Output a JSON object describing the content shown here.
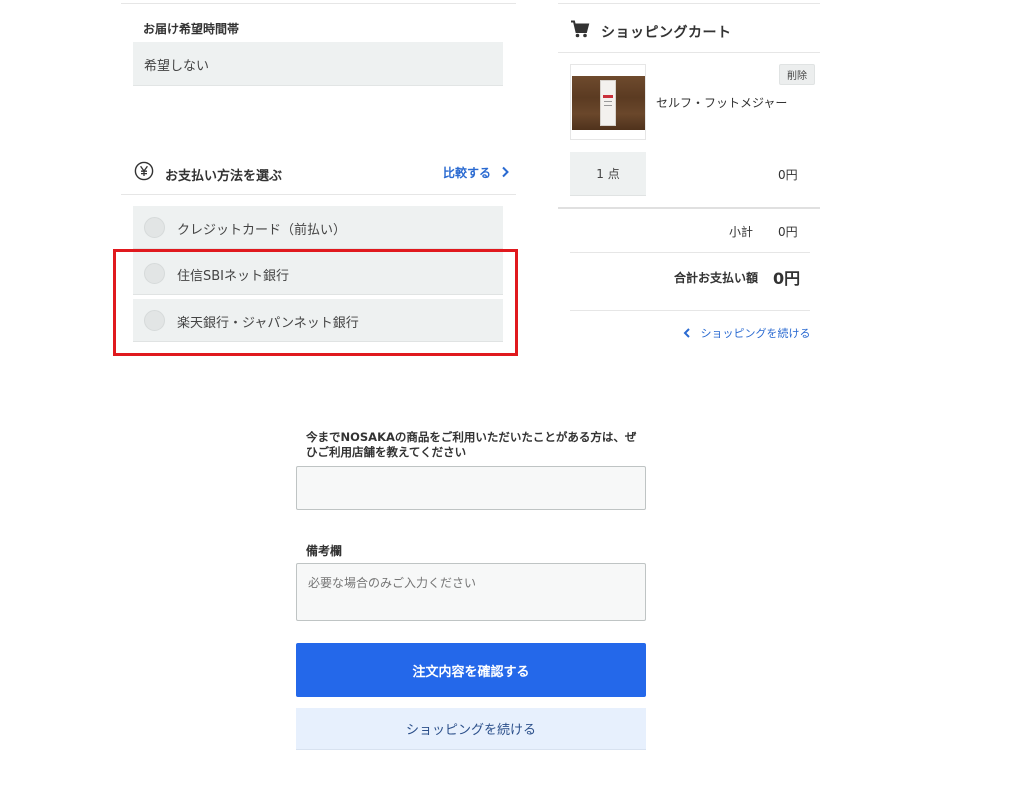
{
  "delivery": {
    "time_label": "お届け希望時間帯",
    "time_value": "希望しない"
  },
  "payment": {
    "icon": "yen-circle-icon",
    "title": "お支払い方法を選ぶ",
    "compare_link": "比較する",
    "compare_icon": "chevron-right-icon",
    "options": [
      {
        "label": "クレジットカード（前払い）"
      },
      {
        "label": "住信SBIネット銀行"
      },
      {
        "label": "楽天銀行・ジャパンネット銀行"
      }
    ],
    "highlight_color": "#e0191e"
  },
  "cart": {
    "icon": "shopping-cart-icon",
    "title": "ショッピングカート",
    "item": {
      "name": "セルフ・フットメジャー",
      "delete_label": "削除",
      "quantity": "1 点",
      "price": "0円"
    },
    "subtotal_label": "小計",
    "subtotal_value": "0円",
    "total_label": "合計お支払い額",
    "total_value": "0円",
    "continue_link": "ショッピングを続ける",
    "continue_icon": "chevron-left-icon"
  },
  "form": {
    "store_question": "今までNOSAKAの商品をご利用いただいたことがある方は、ぜひご利用店舗を教えてください",
    "store_value": "",
    "notes_label": "備考欄",
    "notes_placeholder": "必要な場合のみご入力ください",
    "confirm_button": "注文内容を確認する",
    "continue_button": "ショッピングを続ける"
  },
  "colors": {
    "primary": "#2468ea",
    "link": "#2a6ad1",
    "panel": "#eef1f1"
  }
}
